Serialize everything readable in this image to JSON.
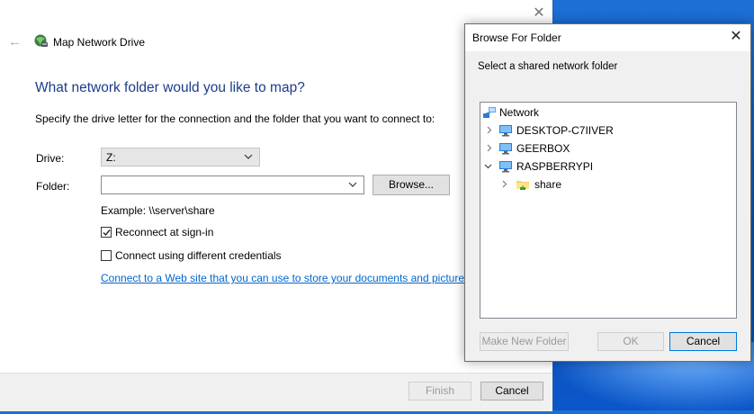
{
  "wizard": {
    "title": "Map Network Drive",
    "heading": "What network folder would you like to map?",
    "instruction": "Specify the drive letter for the connection and the folder that you want to connect to:",
    "drive_label": "Drive:",
    "drive_value": "Z:",
    "folder_label": "Folder:",
    "folder_value": "",
    "browse_label": "Browse...",
    "example": "Example: \\\\server\\share",
    "reconnect_label": "Reconnect at sign-in",
    "reconnect_checked": true,
    "credentials_label": "Connect using different credentials",
    "credentials_checked": false,
    "web_link": "Connect to a Web site that you can use to store your documents and pictures",
    "finish_label": "Finish",
    "cancel_label": "Cancel"
  },
  "browse_dialog": {
    "title": "Browse For Folder",
    "instruction": "Select a shared network folder",
    "tree": [
      {
        "label": "Network",
        "icon": "network-icon",
        "expanded": true
      },
      {
        "label": "DESKTOP-C7IIVER",
        "icon": "computer-icon",
        "expanded": false
      },
      {
        "label": "GEERBOX",
        "icon": "computer-icon",
        "expanded": false
      },
      {
        "label": "RASPBERRYPI",
        "icon": "computer-icon",
        "expanded": true,
        "selected": true
      },
      {
        "label": "share",
        "icon": "shared-folder-icon",
        "expanded": false
      }
    ],
    "make_new_folder_label": "Make New Folder",
    "ok_label": "OK",
    "cancel_label": "Cancel"
  },
  "colors": {
    "heading": "#1c3c8c",
    "link": "#0066cc",
    "selection": "#cce8ff",
    "desktop": "#0a4fb6"
  }
}
